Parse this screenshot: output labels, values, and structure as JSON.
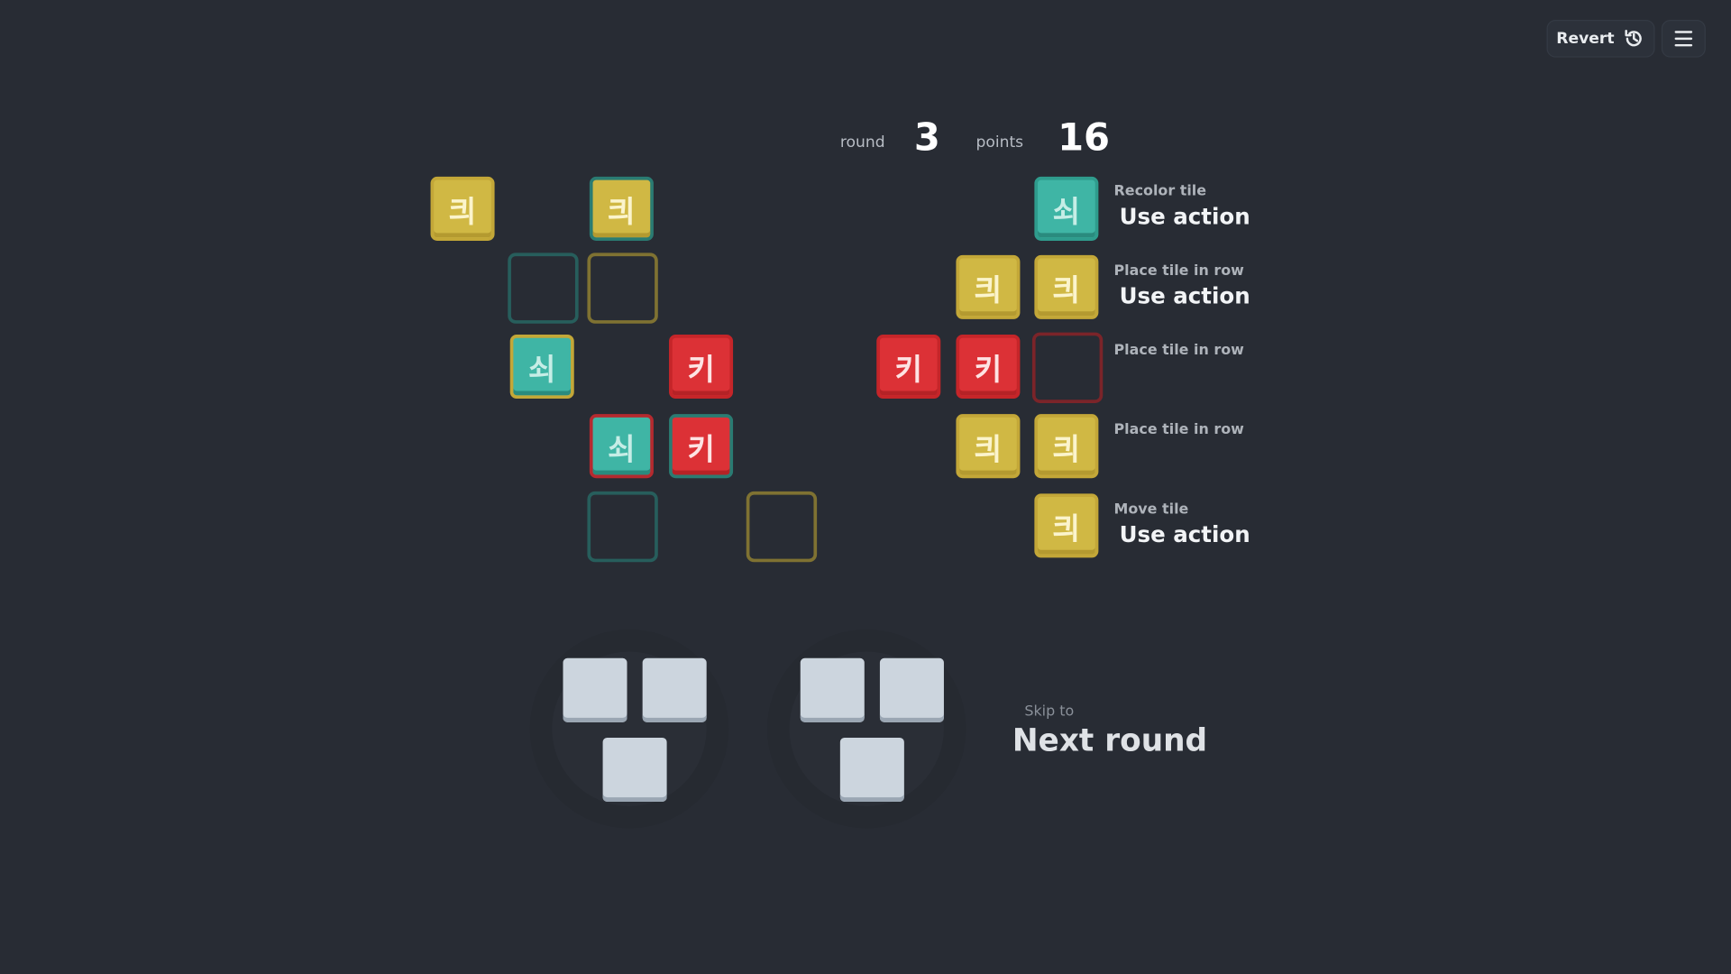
{
  "header": {
    "revert_label": "Revert",
    "revert_icon": "history-icon",
    "menu_icon": "hamburger-menu-icon"
  },
  "stats": {
    "round_label": "round",
    "round_value": "3",
    "points_label": "points",
    "points_value": "16"
  },
  "glyphs": {
    "yellow": "킈",
    "teal": "쇠",
    "red": "키"
  },
  "colors": {
    "yellow": "#d0b844",
    "teal": "#3fb5a5",
    "red": "#dc3136",
    "background": "#282c34",
    "empty_tile": "#ccd5de"
  },
  "actions": [
    {
      "title": "Recolor tile",
      "action": "Use action"
    },
    {
      "title": "Place tile in row",
      "action": "Use action"
    },
    {
      "title": "Place tile in row",
      "action": ""
    },
    {
      "title": "Place tile in row",
      "action": ""
    },
    {
      "title": "Move tile",
      "action": "Use action"
    }
  ],
  "factories": [
    {
      "tiles": 3
    },
    {
      "tiles": 3
    }
  ],
  "skip": {
    "label": "Skip to",
    "target": "Next round"
  }
}
